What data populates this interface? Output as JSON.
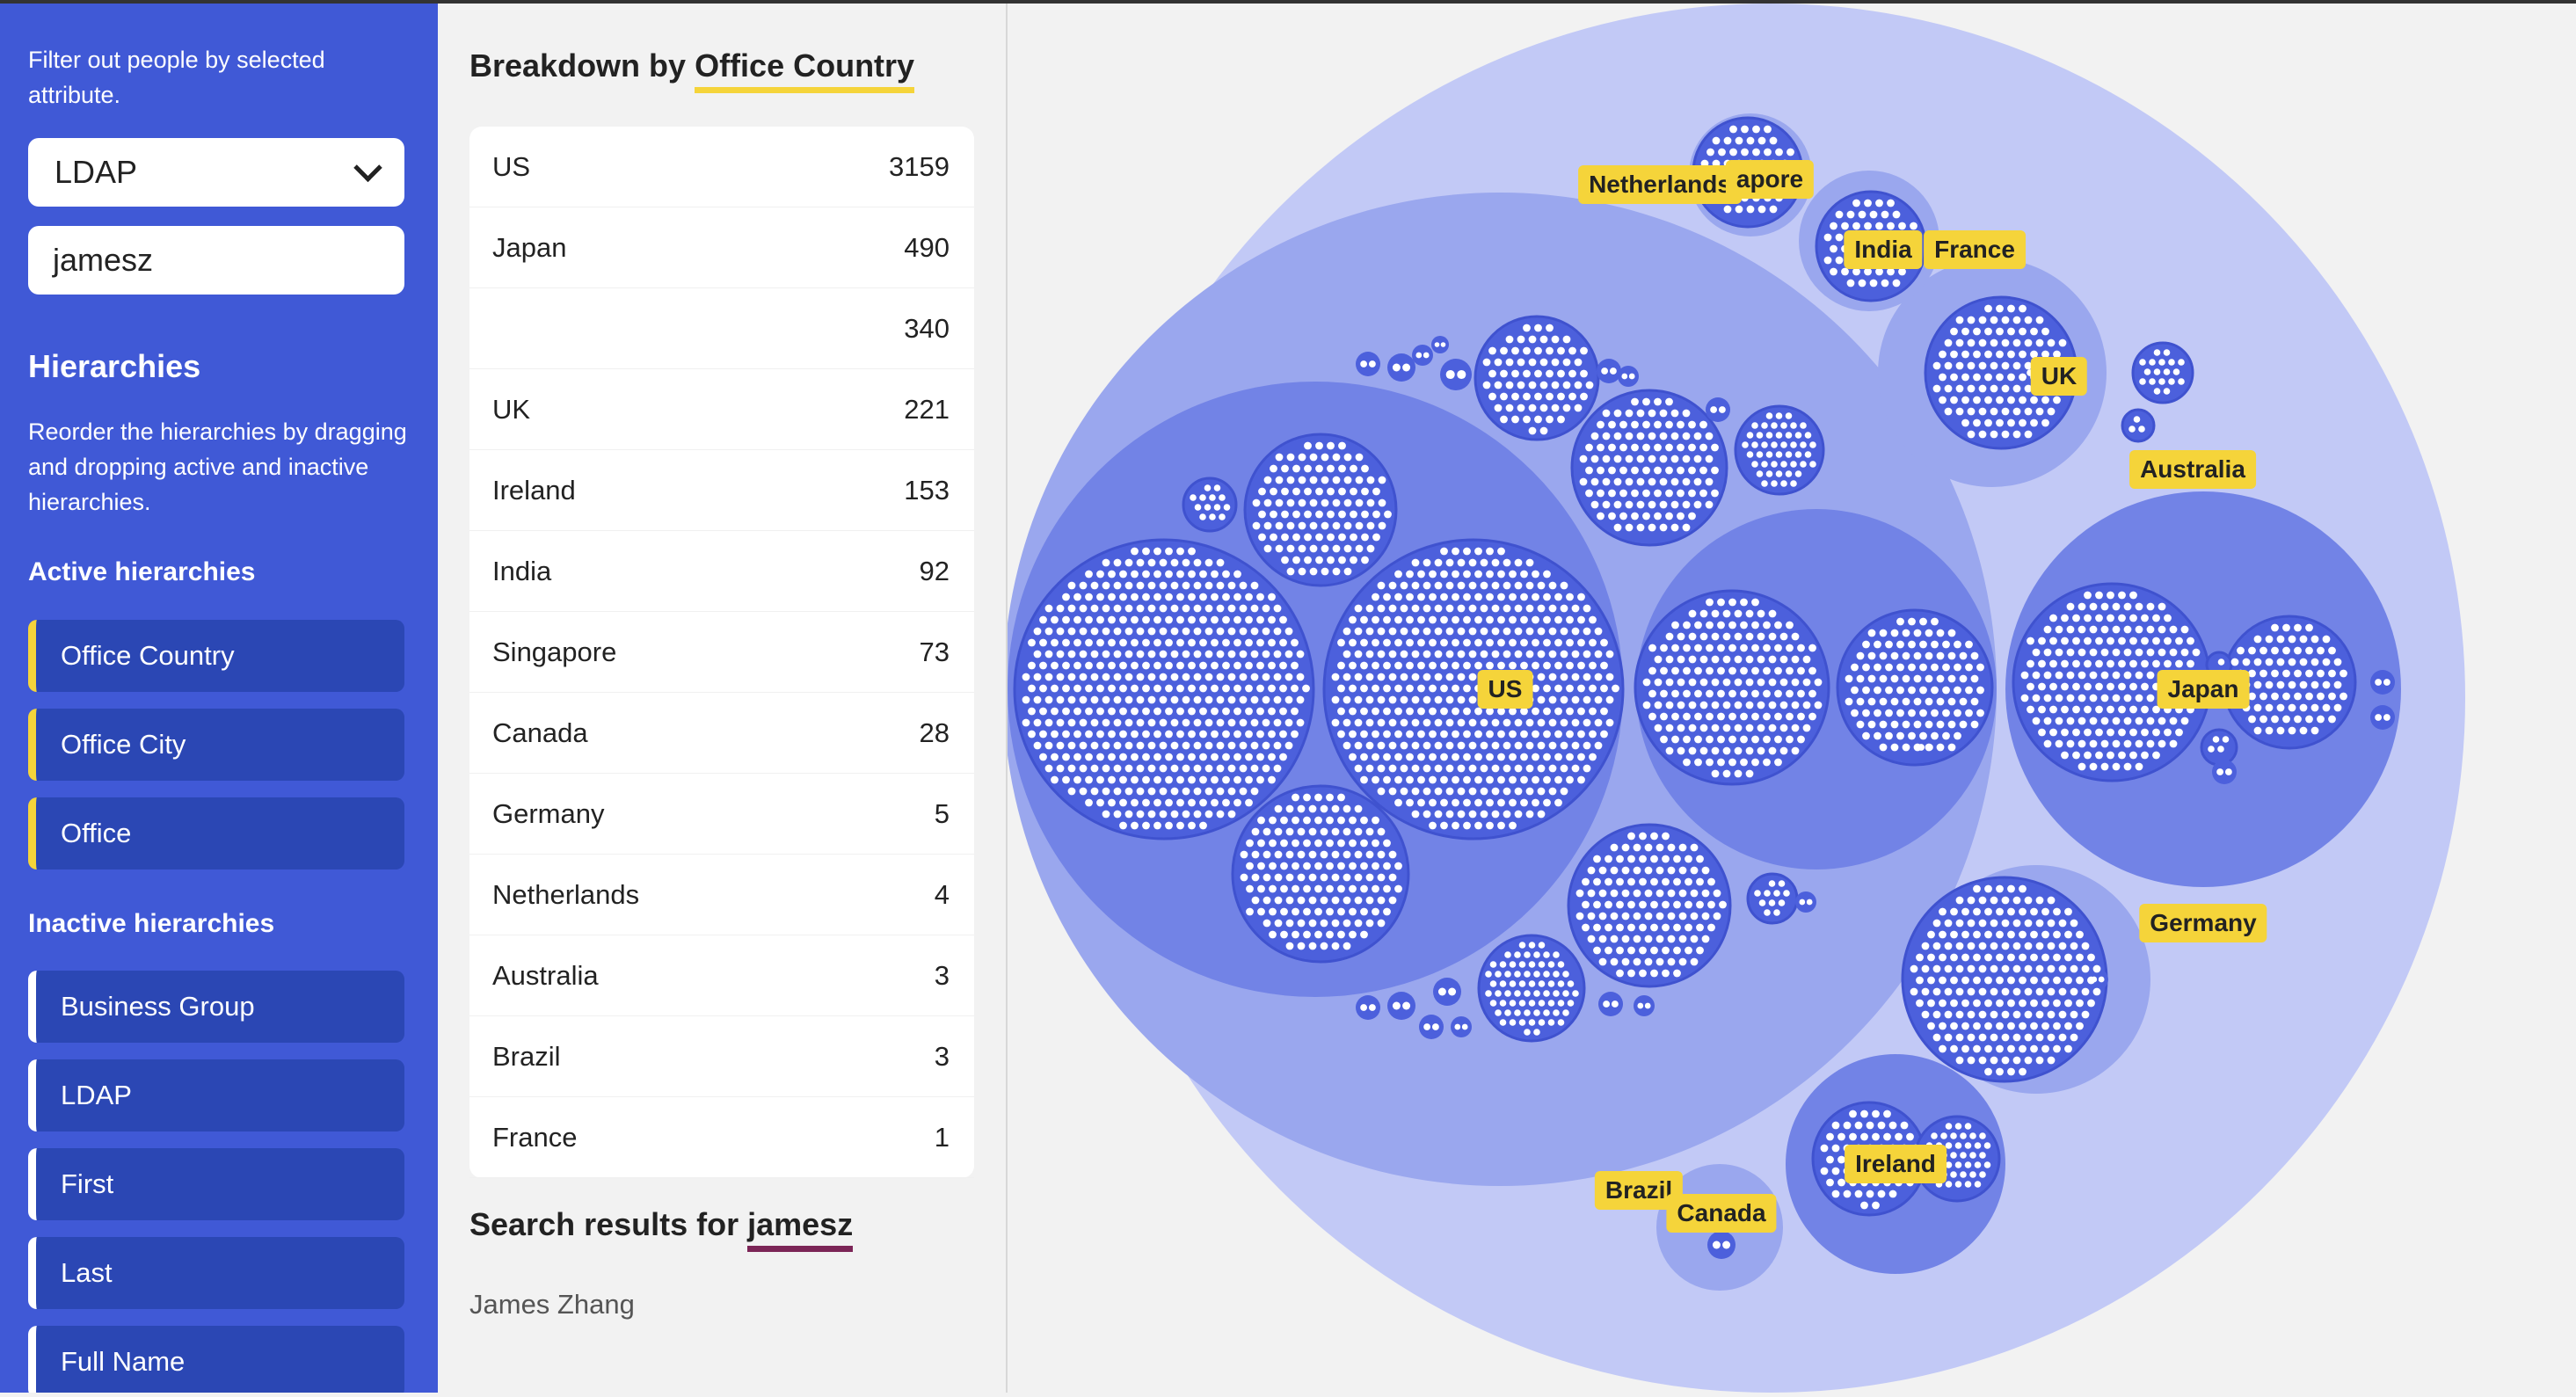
{
  "sidebar": {
    "filter_help": "Filter out people by selected attribute.",
    "filter_select_value": "LDAP",
    "filter_input_value": "jamesz",
    "hierarchies_title": "Hierarchies",
    "hierarchies_help": "Reorder the hierarchies by dragging and dropping active and inactive hierarchies.",
    "active_title": "Active hierarchies",
    "active": [
      "Office Country",
      "Office City",
      "Office"
    ],
    "inactive_title": "Inactive hierarchies",
    "inactive": [
      "Business Group",
      "LDAP",
      "First",
      "Last",
      "Full Name"
    ]
  },
  "breakdown": {
    "title_prefix": "Breakdown by ",
    "title_attr": "Office Country",
    "rows": [
      {
        "name": "US",
        "count": "3159"
      },
      {
        "name": "Japan",
        "count": "490"
      },
      {
        "name": "",
        "count": "340"
      },
      {
        "name": "UK",
        "count": "221"
      },
      {
        "name": "Ireland",
        "count": "153"
      },
      {
        "name": "India",
        "count": "92"
      },
      {
        "name": "Singapore",
        "count": "73"
      },
      {
        "name": "Canada",
        "count": "28"
      },
      {
        "name": "Germany",
        "count": "5"
      },
      {
        "name": "Netherlands",
        "count": "4"
      },
      {
        "name": "Australia",
        "count": "3"
      },
      {
        "name": "Brazil",
        "count": "3"
      },
      {
        "name": "France",
        "count": "1"
      }
    ]
  },
  "search": {
    "title_prefix": "Search results for ",
    "query": "jamesz",
    "results": [
      "James Zhang"
    ]
  },
  "chart": {
    "labels": [
      "Netherlands",
      "apore",
      "India",
      "France",
      "UK",
      "Australia",
      "US",
      "Japan",
      "Germany",
      "Ireland",
      "Brazil",
      "Canada"
    ]
  },
  "colors": {
    "sidebar": "#4059d6",
    "hier_item": "#2b47b4",
    "accent_yellow": "#f5d43a",
    "accent_purple": "#7c2557",
    "circle_outer": "#c2c9f6",
    "circle_mid": "#9aa7ee",
    "circle_inner": "#7283e6",
    "circle_leaf": "#4c60dc"
  }
}
